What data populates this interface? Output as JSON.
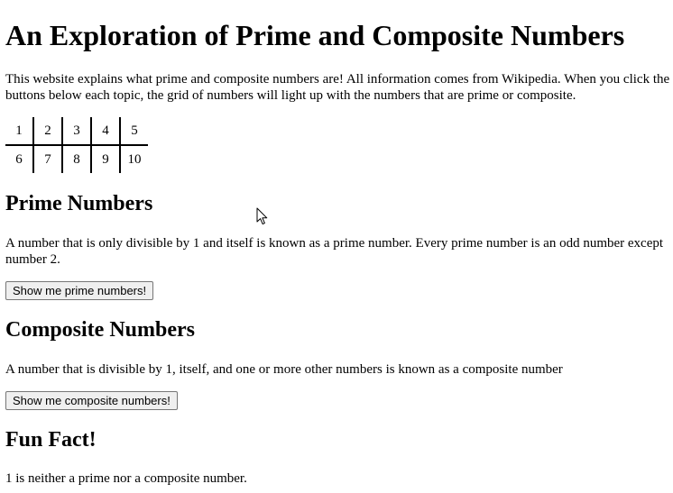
{
  "page": {
    "title": "An Exploration of Prime and Composite Numbers",
    "intro": "This website explains what prime and composite numbers are! All information comes from Wikipedia. When you click the buttons below each topic, the grid of numbers will light up with the numbers that are prime or composite."
  },
  "grid": {
    "rows": [
      [
        "1",
        "2",
        "3",
        "4",
        "5"
      ],
      [
        "6",
        "7",
        "8",
        "9",
        "10"
      ]
    ]
  },
  "prime": {
    "heading": "Prime Numbers",
    "text": "A number that is only divisible by 1 and itself is known as a prime number. Every prime number is an odd number except number 2.",
    "button_label": "Show me prime numbers!"
  },
  "composite": {
    "heading": "Composite Numbers",
    "text": "A number that is divisible by 1, itself, and one or more other numbers is known as a composite number",
    "button_label": "Show me composite numbers!"
  },
  "fun_fact": {
    "heading": "Fun Fact!",
    "text": "1 is neither a prime nor a composite number."
  },
  "icons": {
    "cursor": "mouse-pointer-icon"
  }
}
